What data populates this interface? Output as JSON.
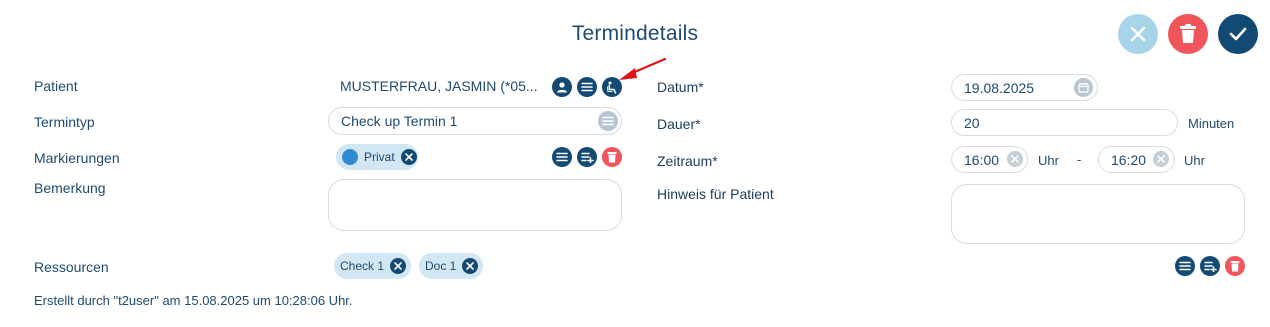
{
  "dialog": {
    "title": "Termindetails"
  },
  "header_buttons": {
    "close": "close-icon",
    "delete": "trash-icon",
    "confirm": "check-icon"
  },
  "left": {
    "patient_label": "Patient",
    "patient_value": "MUSTERFRAU, JASMIN (*05...",
    "termintyp_label": "Termintyp",
    "termintyp_value": "Check up Termin 1",
    "markierungen_label": "Markierungen",
    "markierungen_chip": "Privat",
    "bemerkung_label": "Bemerkung",
    "bemerkung_value": ""
  },
  "right": {
    "datum_label": "Datum*",
    "datum_value": "19.08.2025",
    "dauer_label": "Dauer*",
    "dauer_value": "20",
    "dauer_unit": "Minuten",
    "zeitraum_label": "Zeitraum*",
    "zeit_von": "16:00",
    "zeit_bis": "16:20",
    "uhr_label": "Uhr",
    "separator": "-",
    "hinweis_label": "Hinweis für Patient",
    "hinweis_value": ""
  },
  "ressourcen": {
    "label": "Ressourcen",
    "chips": [
      "Check 1",
      "Doc 1"
    ]
  },
  "footer": {
    "text": "Erstellt durch \"t2user\" am 15.08.2025 um 10:28:06 Uhr."
  },
  "colors": {
    "primary": "#134a73",
    "danger": "#f0555c",
    "light": "#a8d4ea",
    "chip": "#d3e6f3",
    "arrow": "#e0121a"
  }
}
